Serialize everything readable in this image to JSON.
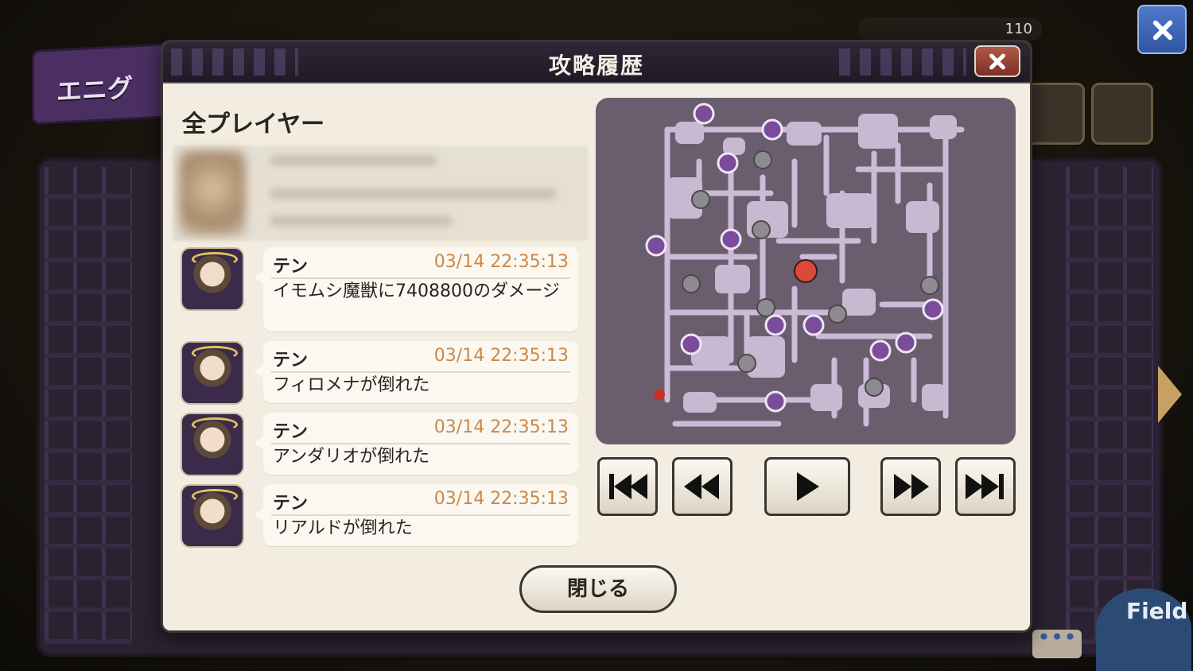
{
  "dialog": {
    "title": "攻略履歴",
    "section_label": "全プレイヤー",
    "close_label": "閉じる"
  },
  "background": {
    "banner_text": "エニグ",
    "counter_text": "110",
    "field_label": "Field",
    "chat_text": "•••"
  },
  "log": [
    {
      "name": "テン",
      "time": "03/14 22:35:13",
      "message": "イモムシ魔獣に7408800のダメージ"
    },
    {
      "name": "テン",
      "time": "03/14 22:35:13",
      "message": "フィロメナが倒れた"
    },
    {
      "name": "テン",
      "time": "03/14 22:35:13",
      "message": "アンダリオが倒れた"
    },
    {
      "name": "テン",
      "time": "03/14 22:35:13",
      "message": "リアルドが倒れた"
    }
  ],
  "playback": [
    {
      "name": "skip-to-start-button",
      "icon": "skip-to-start-icon"
    },
    {
      "name": "rewind-button",
      "icon": "rewind-icon"
    },
    {
      "name": "play-button",
      "icon": "play-icon"
    },
    {
      "name": "fast-forward-button",
      "icon": "fast-forward-icon"
    },
    {
      "name": "skip-to-end-button",
      "icon": "skip-to-end-icon"
    }
  ],
  "colors": {
    "map_bg": "#6a5e6e",
    "room": "#c9b8d2",
    "path": "#cdbad7",
    "enemy_gray": "#8d8b90",
    "orb": "#7b4c9a",
    "boss": "#d94a38"
  }
}
